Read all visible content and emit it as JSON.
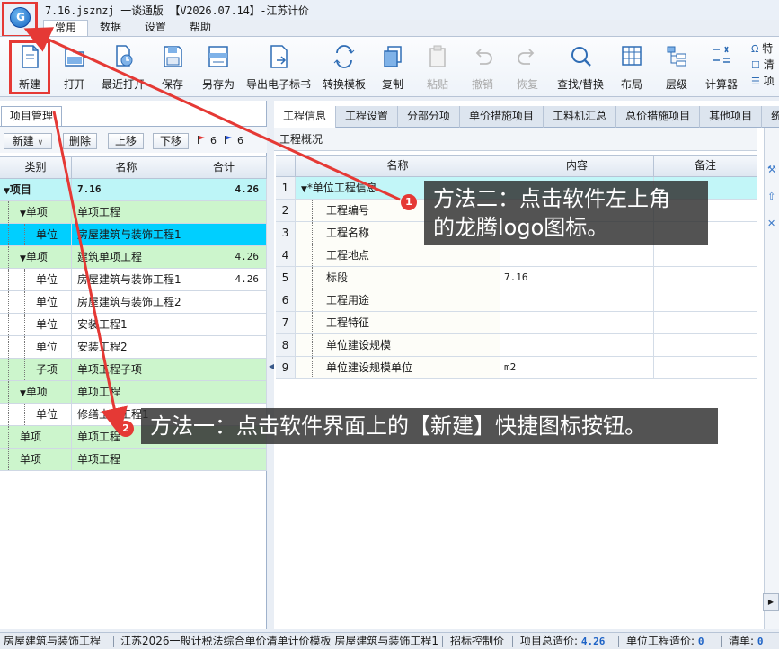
{
  "app": {
    "title": "7.16.jsznzj 一谈通版 【V2026.07.14】-江苏计价",
    "logo_icon": "longteng-logo-icon"
  },
  "menu_tabs": [
    "常用",
    "数据",
    "设置",
    "帮助"
  ],
  "ribbon": {
    "buttons": [
      {
        "label": "新建",
        "icon": "new-file-icon"
      },
      {
        "label": "打开",
        "icon": "open-folder-icon"
      },
      {
        "label": "最近打开",
        "icon": "recent-icon"
      },
      {
        "label": "保存",
        "icon": "save-icon"
      },
      {
        "label": "另存为",
        "icon": "save-as-icon"
      },
      {
        "label": "导出电子标书",
        "icon": "export-icon"
      },
      {
        "label": "转换模板",
        "icon": "convert-icon"
      },
      {
        "label": "复制",
        "icon": "copy-icon"
      },
      {
        "label": "粘贴",
        "icon": "paste-icon",
        "disabled": true
      },
      {
        "label": "撤销",
        "icon": "undo-icon",
        "disabled": true
      },
      {
        "label": "恢复",
        "icon": "redo-icon",
        "disabled": true
      },
      {
        "label": "查找/替换",
        "icon": "search-icon"
      },
      {
        "label": "布局",
        "icon": "layout-icon"
      },
      {
        "label": "层级",
        "icon": "hierarchy-icon"
      },
      {
        "label": "计算器",
        "icon": "calculator-icon"
      }
    ],
    "side_items": [
      "特",
      "清",
      "项"
    ]
  },
  "left_panel": {
    "tab": "项目管理",
    "toolbar": {
      "new_label": "新建",
      "delete_label": "删除",
      "up_label": "上移",
      "down_label": "下移",
      "red_flag_count": "6",
      "blue_flag_count": "6"
    },
    "columns": [
      "类别",
      "名称",
      "合计"
    ],
    "rows": [
      {
        "category": "项目",
        "name": "7.16",
        "total": "4.26",
        "level": 0,
        "style": "blue",
        "expander": "▼"
      },
      {
        "category": "单项",
        "name": "单项工程",
        "total": "",
        "level": 1,
        "style": "green",
        "expander": "▼"
      },
      {
        "category": "单位",
        "name": "房屋建筑与装饰工程1",
        "total": "",
        "level": 2,
        "style": "sel",
        "expander": ""
      },
      {
        "category": "单项",
        "name": "建筑单项工程",
        "total": "4.26",
        "level": 1,
        "style": "green",
        "expander": "▼"
      },
      {
        "category": "单位",
        "name": "房屋建筑与装饰工程1",
        "total": "4.26",
        "level": 2,
        "style": "white",
        "expander": ""
      },
      {
        "category": "单位",
        "name": "房屋建筑与装饰工程2",
        "total": "",
        "level": 2,
        "style": "white",
        "expander": ""
      },
      {
        "category": "单位",
        "name": "安装工程1",
        "total": "",
        "level": 2,
        "style": "white",
        "expander": ""
      },
      {
        "category": "单位",
        "name": "安装工程2",
        "total": "",
        "level": 2,
        "style": "white",
        "expander": ""
      },
      {
        "category": "子项",
        "name": "单项工程子项",
        "total": "",
        "level": 2,
        "style": "green",
        "expander": ""
      },
      {
        "category": "单项",
        "name": "单项工程",
        "total": "",
        "level": 1,
        "style": "green",
        "expander": "▼"
      },
      {
        "category": "单位",
        "name": "修缮土建工程1",
        "total": "",
        "level": 2,
        "style": "white",
        "expander": ""
      },
      {
        "category": "单项",
        "name": "单项工程",
        "total": "",
        "level": 1,
        "style": "green",
        "expander": ""
      },
      {
        "category": "单项",
        "name": "单项工程",
        "total": "",
        "level": 1,
        "style": "green",
        "expander": ""
      }
    ]
  },
  "right_panel": {
    "tabs": [
      "工程信息",
      "工程设置",
      "分部分项",
      "单价措施项目",
      "工料机汇总",
      "总价措施项目",
      "其他项目",
      "统"
    ],
    "sub_header": "工程概况",
    "columns": [
      "名称",
      "内容",
      "备注"
    ],
    "rows": [
      {
        "no": "1",
        "name": "单位工程信息",
        "content": "",
        "note": "",
        "group": true
      },
      {
        "no": "2",
        "name": "工程编号",
        "content": "",
        "note": ""
      },
      {
        "no": "3",
        "name": "工程名称",
        "content": "",
        "note": ""
      },
      {
        "no": "4",
        "name": "工程地点",
        "content": "",
        "note": ""
      },
      {
        "no": "5",
        "name": "标段",
        "content": "7.16",
        "note": ""
      },
      {
        "no": "6",
        "name": "工程用途",
        "content": "",
        "note": ""
      },
      {
        "no": "7",
        "name": "工程特征",
        "content": "",
        "note": ""
      },
      {
        "no": "8",
        "name": "单位建设规模",
        "content": "",
        "note": ""
      },
      {
        "no": "9",
        "name": "单位建设规模单位",
        "content": "m2",
        "note": ""
      }
    ]
  },
  "status_bar": {
    "unit": "房屋建筑与装饰工程",
    "template": "江苏2026一般计税法综合单价清单计价模板 房屋建筑与装饰工程1",
    "control_price": "招标控制价",
    "total_label": "项目总造价:",
    "total_value": "4.26",
    "unit_price_label": "单位工程造价:",
    "unit_price_value": "0",
    "list_label": "清单:",
    "list_value": "0"
  },
  "annotations": [
    {
      "badge": "1",
      "text_line1": "方法二：点击软件左上角",
      "text_line2": "的龙腾logo图标。"
    },
    {
      "badge": "2",
      "text": "方法一：点击软件界面上的【新建】快捷图标按钮。"
    }
  ],
  "colors": {
    "annotation_red": "#e53935",
    "selected_row": "#00cfff",
    "green_row": "#ccf5cc",
    "status_value": "#1e63c6"
  }
}
